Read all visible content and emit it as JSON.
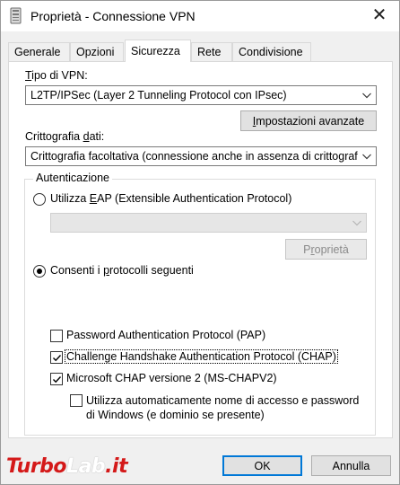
{
  "window": {
    "title": "Proprietà - Connessione VPN",
    "close_glyph": "✕"
  },
  "tabs": [
    {
      "label": "Generale"
    },
    {
      "label": "Opzioni"
    },
    {
      "label": "Sicurezza",
      "active": true
    },
    {
      "label": "Rete"
    },
    {
      "label": "Condivisione"
    }
  ],
  "vpn_type": {
    "label_prefix": "T",
    "label_rest": "ipo di VPN:",
    "value": "L2TP/IPSec (Layer 2 Tunneling Protocol con IPsec)"
  },
  "advanced_button": {
    "label_prefix": "I",
    "label_rest": "mpostazioni avanzate"
  },
  "encryption": {
    "label_before": "Crittografia ",
    "label_accel": "d",
    "label_after": "ati:",
    "value": "Crittografia facoltativa (connessione anche in assenza di crittografia)"
  },
  "auth_group": {
    "title": "Autenticazione",
    "eap_radio": {
      "before": "Utilizza ",
      "accel": "E",
      "after": "AP (Extensible Authentication Protocol)",
      "selected": false
    },
    "eap_combo_value": "",
    "eap_properties_button": {
      "before": "P",
      "accel": "r",
      "after": "oprietà"
    },
    "protocols_radio": {
      "before": "Consenti i ",
      "accel": "p",
      "after": "rotocolli seguenti",
      "selected": true
    },
    "checkboxes": [
      {
        "label": "Password Authentication Protocol (PAP)",
        "checked": false
      },
      {
        "label": "Challenge Handshake Authentication Protocol (CHAP)",
        "checked": true
      },
      {
        "label": "Microsoft CHAP versione 2 (MS-CHAPV2)",
        "checked": true
      }
    ],
    "auto_logon": {
      "line1": "Utilizza automaticamente nome di accesso e password",
      "line2": "di Windows (e dominio se presente)",
      "checked": false
    }
  },
  "footer": {
    "ok_label": "OK",
    "cancel_label": "Annulla"
  },
  "watermark": {
    "part1": "Turbo",
    "part2": "Lab",
    "part3": ".it"
  },
  "colors": {
    "accent": "#0078d7",
    "watermark_red": "#d41919"
  }
}
